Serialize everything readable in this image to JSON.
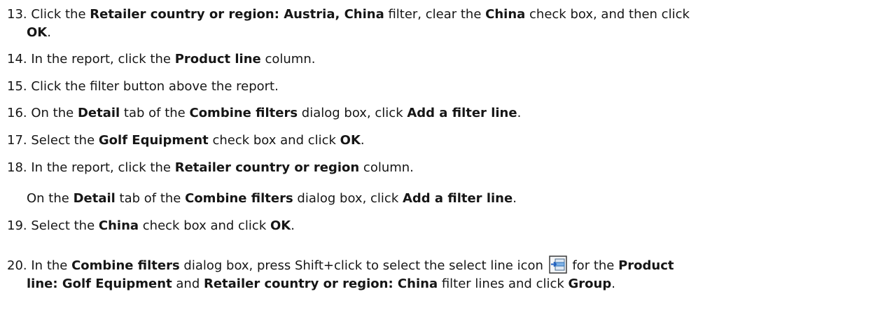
{
  "steps": [
    {
      "num": "13.",
      "t1": "Click the ",
      "b1": "Retailer country or region: Austria, China",
      "t2": " filter, clear the ",
      "b2": "China",
      "t3": " check box, and then click",
      "b3": "OK",
      "t4": "."
    },
    {
      "num": "14.",
      "t1": "In the report, click the ",
      "b1": "Product line",
      "t2": " column."
    },
    {
      "num": "15.",
      "t1": "Click the filter button above the report."
    },
    {
      "num": "16.",
      "t1": "On the ",
      "b1": "Detail",
      "t2": " tab of the ",
      "b2": "Combine filters",
      "t3": " dialog box, click ",
      "b3": "Add a filter line",
      "t4": "."
    },
    {
      "num": "17.",
      "t1": "Select the ",
      "b1": "Golf Equipment",
      "t2": " check box and click ",
      "b2": "OK",
      "t3": "."
    },
    {
      "num": "18.",
      "t1": "In the report, click the ",
      "b1": "Retailer country or region",
      "t2": " column."
    },
    {
      "num": "19.",
      "t1": "Select the ",
      "b1": "China",
      "t2": " check box and click ",
      "b2": "OK",
      "t3": "."
    },
    {
      "num": "20.",
      "t1": "In the ",
      "b1": "Combine filters",
      "t2": " dialog box, press Shift+click to select the select line icon ",
      "t3": " for the ",
      "b2": "Product",
      "b3": "line: Golf Equipment",
      "t4": " and ",
      "b4": "Retailer country or region: China",
      "t5": " filter lines and click ",
      "b5": "Group",
      "t6": "."
    }
  ],
  "note18": {
    "t1": "On the ",
    "b1": "Detail",
    "t2": " tab of the ",
    "b2": "Combine filters",
    "t3": " dialog box, click ",
    "b3": "Add a filter line",
    "t4": "."
  },
  "icons": {
    "select_line": "select-line-icon"
  }
}
